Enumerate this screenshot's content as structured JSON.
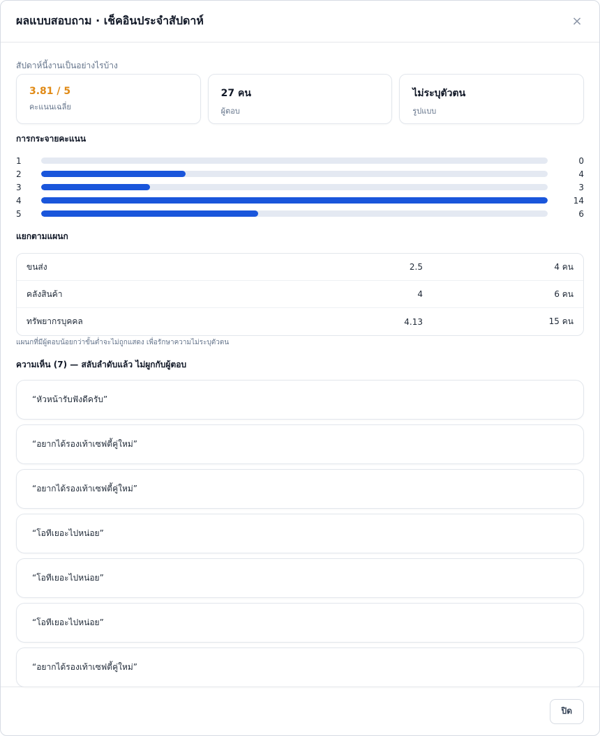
{
  "modal": {
    "title": "ผลแบบสอบถาม · เช็คอินประจำสัปดาห์",
    "close_symbol": "×"
  },
  "summary": {
    "question": "สัปดาห์นี้งานเป็นอย่างไรบ้าง",
    "stats": [
      {
        "value": "3.81 / 5",
        "label": "คะแนนเฉลี่ย"
      },
      {
        "value": "27 คน",
        "label": "ผู้ตอบ"
      },
      {
        "value": "ไม่ระบุตัวตน",
        "label": "รูปแบบ"
      }
    ],
    "accent_color": "#e08a16"
  },
  "distribution": {
    "title": "การกระจายคะแนน",
    "max": 14,
    "rows": [
      {
        "key": "1",
        "count": 0
      },
      {
        "key": "2",
        "count": 4
      },
      {
        "key": "3",
        "count": 3
      },
      {
        "key": "4",
        "count": 14
      },
      {
        "key": "5",
        "count": 6
      }
    ],
    "bar_color": "#1a56db"
  },
  "departments": {
    "title": "แยกตามแผนก",
    "rows": [
      {
        "name": "ขนส่ง",
        "score": "2.5",
        "count": "4 คน"
      },
      {
        "name": "คลังสินค้า",
        "score": "4",
        "count": "6 คน"
      },
      {
        "name": "ทรัพยากรบุคคล",
        "score": "4.13",
        "count": "15 คน"
      }
    ],
    "note": "แผนกที่มีผู้ตอบน้อยกว่าขั้นต่ำจะไม่ถูกแสดง เพื่อรักษาความไม่ระบุตัวตน"
  },
  "comments": {
    "title": "ความเห็น (7) — สลับลำดับแล้ว ไม่ผูกกับผู้ตอบ",
    "items": [
      "“หัวหน้ารับฟังดีครับ”",
      "“อยากได้รองเท้าเซฟตี้คู่ใหม่”",
      "“อยากได้รองเท้าเซฟตี้คู่ใหม่”",
      "“โอทีเยอะไปหน่อย”",
      "“โอทีเยอะไปหน่อย”",
      "“โอทีเยอะไปหน่อย”",
      "“อยากได้รองเท้าเซฟตี้คู่ใหม่”"
    ]
  },
  "footer": {
    "close_label": "ปิด"
  }
}
